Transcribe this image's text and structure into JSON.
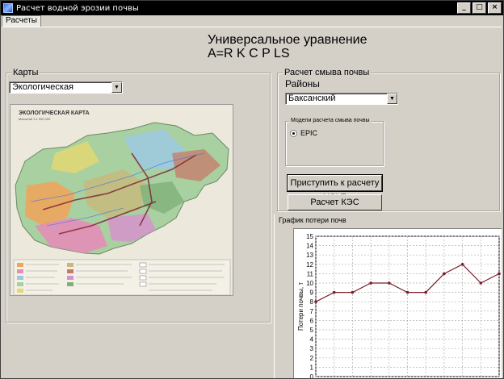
{
  "window": {
    "title": "Расчет водной эрозии почвы",
    "buttons": {
      "minimize": "_",
      "maximize": "□",
      "close": "×"
    }
  },
  "tabs": [
    {
      "label": "Расчеты"
    }
  ],
  "header": {
    "line1": "Универсальное уравнение",
    "line2": "A=R K C P LS"
  },
  "maps": {
    "group_label": "Карты",
    "selected": "Экологическая",
    "image": {
      "title": "ЭКОЛОГИЧЕСКАЯ КАРТА",
      "subtitle": "Масштаб 1:1 000 000"
    }
  },
  "erosion": {
    "group_label": "Расчет смыва почвы",
    "districts_label": "Районы",
    "district_selected": "Баксанский",
    "models_group_label": "Модели расчета смыва почвы",
    "model_option": "EPIC",
    "start_button": "Приступить к расчету USLE",
    "kes_button": "Расчет КЭС"
  },
  "chart_data": {
    "type": "line",
    "title": "График потери почв",
    "ylabel": "Потери почвы, т",
    "ylim": [
      0,
      15
    ],
    "yticks": [
      0,
      1,
      2,
      3,
      4,
      5,
      6,
      7,
      8,
      9,
      10,
      11,
      12,
      13,
      14,
      15
    ],
    "x": [
      0,
      1,
      2,
      3,
      4,
      5,
      6,
      7,
      8,
      9,
      10
    ],
    "values": [
      8,
      9,
      9,
      10,
      10,
      9,
      9,
      11,
      12,
      10,
      11
    ],
    "line_color": "#7a1f2b",
    "grid": true
  }
}
